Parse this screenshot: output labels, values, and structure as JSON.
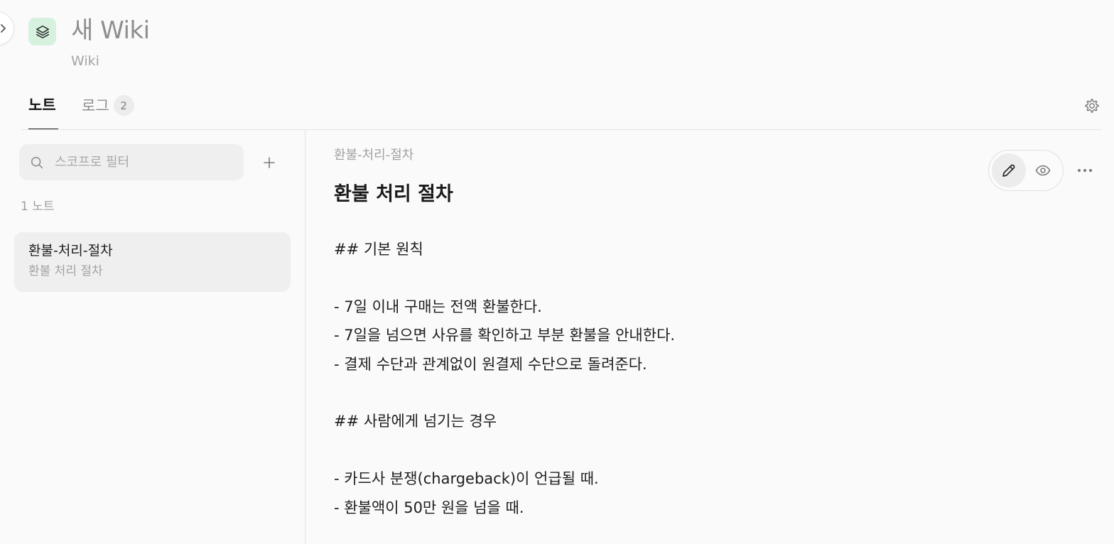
{
  "header": {
    "app_icon": "layers-icon",
    "title": "새 Wiki",
    "subtitle": "Wiki"
  },
  "tabs": {
    "notes_label": "노트",
    "log_label": "로그",
    "log_count": "2"
  },
  "sidebar": {
    "search_placeholder": "스코프로 필터",
    "search_value": "",
    "note_count": "1 노트",
    "notes": [
      {
        "title": "환불-처리-절차",
        "subtitle": "환불 처리 절차"
      }
    ]
  },
  "document": {
    "breadcrumb": "환불-처리-절차",
    "title": "환불 처리 절차",
    "lines": [
      "## 기본 원칙",
      "- 7일 이내 구매는 전액 환불한다.",
      "- 7일을 넘으면 사유를 확인하고 부분 환불을 안내한다.",
      "- 결제 수단과 관계없이 원결제 수단으로 돌려준다.",
      "## 사람에게 넘기는 경우",
      "- 카드사 분쟁(chargeback)이 언급될 때.",
      "- 환불액이 50만 원을 넘을 때."
    ]
  },
  "colors": {
    "background": "#fafafa",
    "app_icon_bg": "#d6f2df",
    "panel": "#efefef",
    "divider": "#e4e4e4"
  }
}
